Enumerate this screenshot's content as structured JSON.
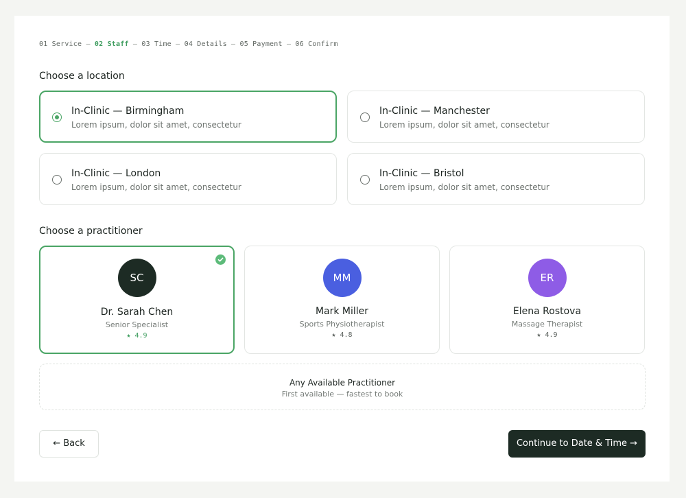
{
  "steps": [
    {
      "label": "01 Service",
      "active": false
    },
    {
      "label": "02 Staff",
      "active": true
    },
    {
      "label": "03 Time",
      "active": false
    },
    {
      "label": "04 Details",
      "active": false
    },
    {
      "label": "05 Payment",
      "active": false
    },
    {
      "label": "06 Confirm",
      "active": false
    }
  ],
  "step_separator": "—",
  "location": {
    "heading": "Choose a location",
    "options": [
      {
        "title": "In-Clinic — Birmingham",
        "description": "Lorem ipsum, dolor sit amet, consectetur",
        "selected": true
      },
      {
        "title": "In-Clinic — Manchester",
        "description": "Lorem ipsum, dolor sit amet, consectetur",
        "selected": false
      },
      {
        "title": "In-Clinic — London",
        "description": "Lorem ipsum, dolor sit amet, consectetur",
        "selected": false
      },
      {
        "title": "In-Clinic — Bristol",
        "description": "Lorem ipsum, dolor sit amet, consectetur",
        "selected": false
      }
    ]
  },
  "practitioner": {
    "heading": "Choose a practitioner",
    "options": [
      {
        "initials": "SC",
        "name": "Dr. Sarah Chen",
        "role": "Senior Specialist",
        "rating": "★ 4.9",
        "avatar_color": "#1d2b24",
        "selected": true
      },
      {
        "initials": "MM",
        "name": "Mark Miller",
        "role": "Sports Physiotherapist",
        "rating": "★ 4.8",
        "avatar_color": "#4a5fe0",
        "selected": false
      },
      {
        "initials": "ER",
        "name": "Elena Rostova",
        "role": "Massage Therapist",
        "rating": "★ 4.9",
        "avatar_color": "#8e5ce6",
        "selected": false
      }
    ],
    "any": {
      "title": "Any Available Practitioner",
      "subtitle": "First available — fastest to book"
    }
  },
  "actions": {
    "back_label": "← Back",
    "continue_label": "Continue to Date & Time →"
  },
  "colors": {
    "accent": "#4aa565",
    "dark": "#1d2b24",
    "check": "#5dbb7a"
  }
}
